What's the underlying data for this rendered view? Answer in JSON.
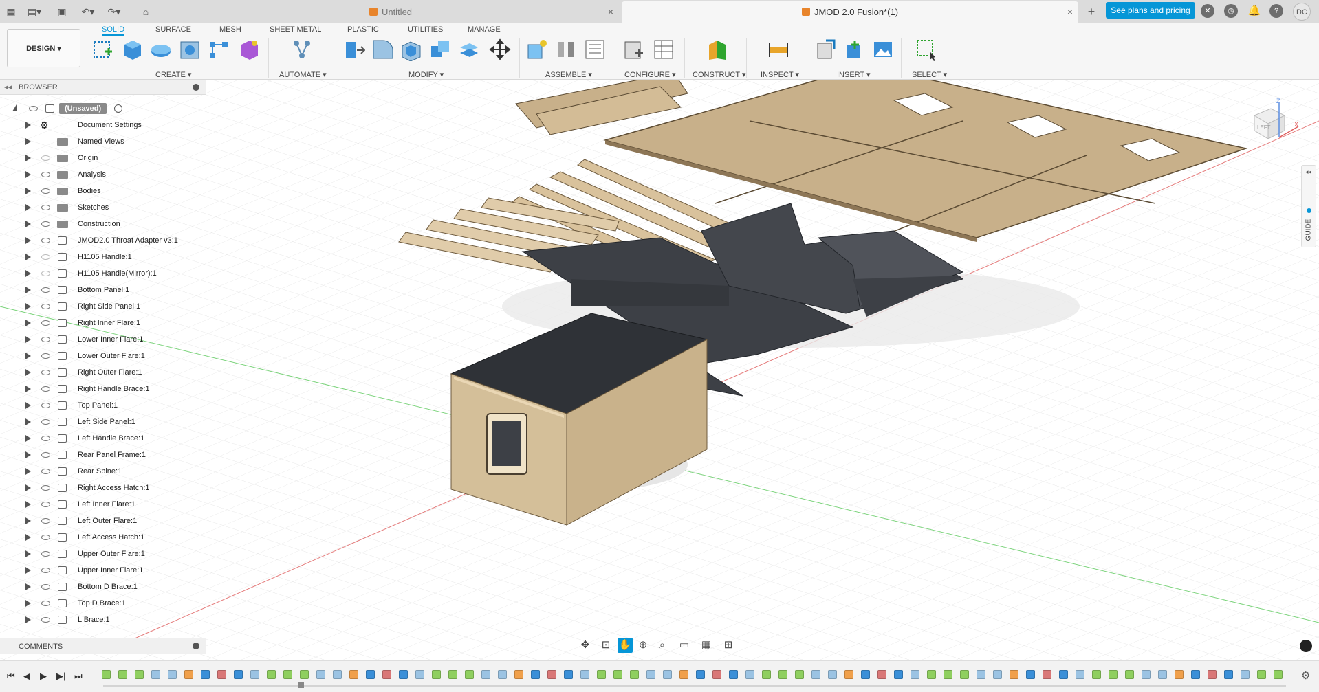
{
  "topbar": {
    "tabs": [
      {
        "label": "Untitled",
        "active": false
      },
      {
        "label": "JMOD 2.0 Fusion*(1)",
        "active": true
      }
    ],
    "plans_button": "See plans and pricing",
    "avatar": "DC",
    "icons": [
      "app-grid-icon",
      "file-icon",
      "save-icon",
      "undo-icon",
      "redo-icon",
      "home-icon",
      "new-tab-icon",
      "extensions-icon",
      "job-status-icon",
      "notifications-icon",
      "help-icon"
    ]
  },
  "ribbon": {
    "workspace": "DESIGN ▾",
    "tabs": [
      "SOLID",
      "SURFACE",
      "MESH",
      "SHEET METAL",
      "PLASTIC",
      "UTILITIES",
      "MANAGE"
    ],
    "active_tab": "SOLID",
    "groups": [
      "CREATE ▾",
      "AUTOMATE ▾",
      "MODIFY ▾",
      "ASSEMBLE ▾",
      "CONFIGURE ▾",
      "CONSTRUCT ▾",
      "INSPECT ▾",
      "INSERT ▾",
      "SELECT ▾"
    ],
    "accent": "#0696d7"
  },
  "browser": {
    "title": "BROWSER",
    "root": "(Unsaved)",
    "items": [
      {
        "label": "Document Settings",
        "icon": "gear",
        "eye": "none"
      },
      {
        "label": "Named Views",
        "icon": "folder",
        "eye": "none"
      },
      {
        "label": "Origin",
        "icon": "folder",
        "eye": "off"
      },
      {
        "label": "Analysis",
        "icon": "folder",
        "eye": "on"
      },
      {
        "label": "Bodies",
        "icon": "folder",
        "eye": "on"
      },
      {
        "label": "Sketches",
        "icon": "folder",
        "eye": "on"
      },
      {
        "label": "Construction",
        "icon": "folder",
        "eye": "on"
      },
      {
        "label": "JMOD2.0 Throat Adapter v3:1",
        "icon": "component-link",
        "eye": "on"
      },
      {
        "label": "H1105 Handle:1",
        "icon": "component",
        "eye": "off"
      },
      {
        "label": "H1105 Handle(Mirror):1",
        "icon": "component",
        "eye": "off"
      },
      {
        "label": "Bottom Panel:1",
        "icon": "component",
        "eye": "on"
      },
      {
        "label": "Right Side Panel:1",
        "icon": "component",
        "eye": "on"
      },
      {
        "label": "Right Inner Flare:1",
        "icon": "component",
        "eye": "on"
      },
      {
        "label": "Lower Inner Flare:1",
        "icon": "component",
        "eye": "on"
      },
      {
        "label": "Lower Outer Flare:1",
        "icon": "component",
        "eye": "on"
      },
      {
        "label": "Right Outer Flare:1",
        "icon": "component",
        "eye": "on"
      },
      {
        "label": "Right Handle Brace:1",
        "icon": "component",
        "eye": "on"
      },
      {
        "label": "Top Panel:1",
        "icon": "component",
        "eye": "on"
      },
      {
        "label": "Left Side Panel:1",
        "icon": "component",
        "eye": "on"
      },
      {
        "label": "Left Handle Brace:1",
        "icon": "component",
        "eye": "on"
      },
      {
        "label": "Rear Panel Frame:1",
        "icon": "component",
        "eye": "on"
      },
      {
        "label": "Rear Spine:1",
        "icon": "component",
        "eye": "on"
      },
      {
        "label": "Right Access Hatch:1",
        "icon": "component",
        "eye": "on"
      },
      {
        "label": "Left Inner Flare:1",
        "icon": "component",
        "eye": "on"
      },
      {
        "label": "Left Outer Flare:1",
        "icon": "component",
        "eye": "on"
      },
      {
        "label": "Left Access Hatch:1",
        "icon": "component",
        "eye": "on"
      },
      {
        "label": "Upper Outer Flare:1",
        "icon": "component",
        "eye": "on"
      },
      {
        "label": "Upper Inner Flare:1",
        "icon": "component",
        "eye": "on"
      },
      {
        "label": "Bottom D Brace:1",
        "icon": "component",
        "eye": "on"
      },
      {
        "label": "Top D Brace:1",
        "icon": "component",
        "eye": "on"
      },
      {
        "label": "L Brace:1",
        "icon": "component",
        "eye": "on"
      }
    ]
  },
  "comments": {
    "title": "COMMENTS"
  },
  "viewcube": {
    "face": "LEFT",
    "axis_labels": [
      "Z",
      "X"
    ]
  },
  "guide_tab": "GUIDE",
  "navbar": {
    "icons": [
      "orbit-icon",
      "look-at-icon",
      "pan-icon",
      "zoom-window-icon",
      "zoom-icon",
      "display-settings-icon",
      "grid-icon",
      "viewports-icon"
    ],
    "active": "pan-icon"
  },
  "timeline": {
    "controls": [
      "first-icon",
      "previous-icon",
      "play-icon",
      "next-icon",
      "last-icon"
    ],
    "feature_count": 72
  }
}
